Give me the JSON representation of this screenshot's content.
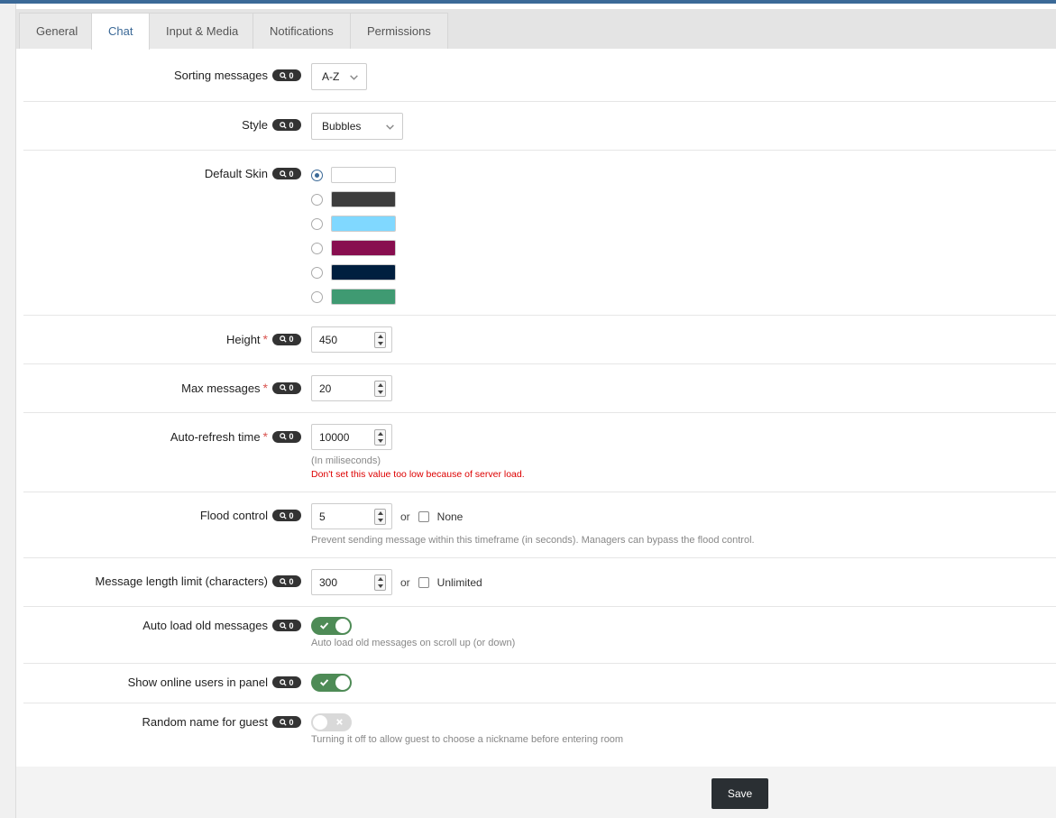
{
  "tabs": [
    {
      "label": "General"
    },
    {
      "label": "Chat"
    },
    {
      "label": "Input & Media"
    },
    {
      "label": "Notifications"
    },
    {
      "label": "Permissions"
    }
  ],
  "active_tab": "Chat",
  "badge_count": "0",
  "colors": {
    "accent": "#3b6997",
    "toggle_on": "#4e8b56",
    "required": "#d9534f"
  },
  "fields": {
    "sorting": {
      "label": "Sorting messages",
      "value": "A-Z"
    },
    "style": {
      "label": "Style",
      "value": "Bubbles"
    },
    "skin": {
      "label": "Default Skin",
      "options": [
        {
          "color": "#ffffff",
          "selected": true
        },
        {
          "color": "#3d3d3d",
          "selected": false
        },
        {
          "color": "#80d8ff",
          "selected": false
        },
        {
          "color": "#880e4f",
          "selected": false
        },
        {
          "color": "#001f3f",
          "selected": false
        },
        {
          "color": "#3f9a72",
          "selected": false
        }
      ]
    },
    "height": {
      "label": "Height",
      "value": "450"
    },
    "max_messages": {
      "label": "Max messages",
      "value": "20"
    },
    "auto_refresh": {
      "label": "Auto-refresh time",
      "value": "10000",
      "help": "(In miliseconds)",
      "warning": "Don't set this value too low because of server load."
    },
    "flood": {
      "label": "Flood control",
      "value": "5",
      "or": "or",
      "checkbox_label": "None",
      "help": "Prevent sending message within this timeframe (in seconds). Managers can bypass the flood control."
    },
    "length": {
      "label": "Message length limit (characters)",
      "value": "300",
      "or": "or",
      "checkbox_label": "Unlimited"
    },
    "auto_load": {
      "label": "Auto load old messages",
      "on": true,
      "help": "Auto load old messages on scroll up (or down)"
    },
    "online_users": {
      "label": "Show online users in panel",
      "on": true
    },
    "random_name": {
      "label": "Random name for guest",
      "on": false,
      "help": "Turning it off to allow guest to choose a nickname before entering room"
    }
  },
  "save_label": "Save"
}
